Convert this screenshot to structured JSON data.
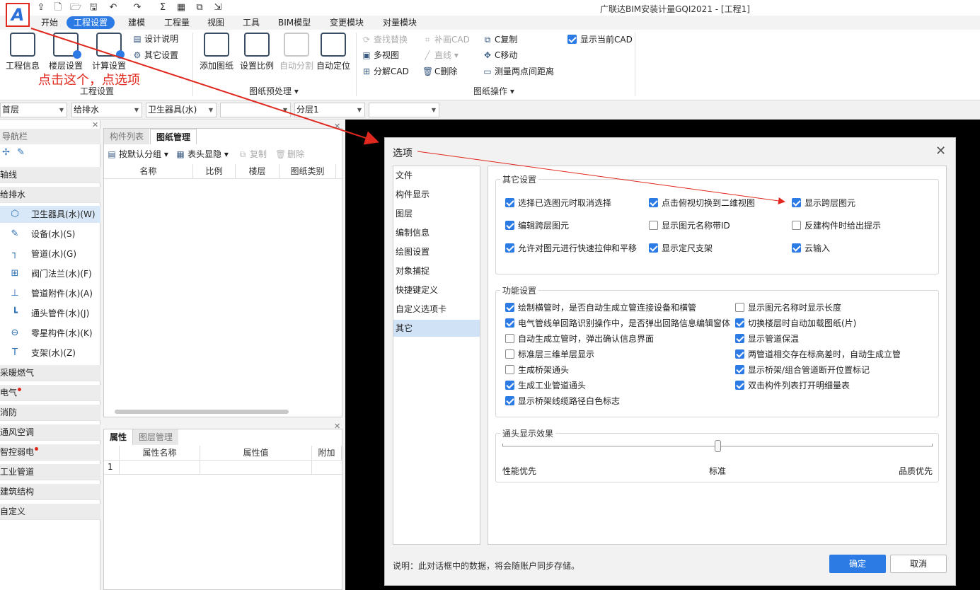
{
  "app": {
    "title": "广联达BIM安装计量GQI2021 - [工程1]",
    "logo_letter": "A"
  },
  "quick_access": [
    "upload-icon",
    "new-file-icon",
    "open-folder-icon",
    "save-icon",
    "undo-icon",
    "redo-icon",
    "sync-icon",
    "sum-icon",
    "grid-icon",
    "copy-icon",
    "export-icon"
  ],
  "menu": [
    {
      "label": "开始"
    },
    {
      "label": "工程设置",
      "active": true
    },
    {
      "label": "建模"
    },
    {
      "label": "工程量"
    },
    {
      "label": "视图"
    },
    {
      "label": "工具"
    },
    {
      "label": "BIM模型"
    },
    {
      "label": "变更模块"
    },
    {
      "label": "对量模块"
    }
  ],
  "ribbon": {
    "project_info": "工程信息",
    "floor_settings": "楼层设置",
    "calc_settings": "计算设置",
    "design_notes": "设计说明",
    "other_settings": "其它设置",
    "group_project": "工程设置",
    "add_drawing": "添加图纸",
    "set_scale": "设置比例",
    "auto_split": "自动分割",
    "auto_locate": "自动定位",
    "group_preprocess": "图纸预处理",
    "find_replace": "查找替换",
    "patch_cad": "补画CAD",
    "c_copy": "C复制",
    "show_current_cad": "显示当前CAD",
    "multi_view": "多视图",
    "line": "直线",
    "c_move": "C移动",
    "split_cad": "分解CAD",
    "c_delete": "C删除",
    "measure_distance": "测量两点间距离",
    "group_drawing_ops": "图纸操作"
  },
  "annotation": "点击这个，点选项",
  "selects": [
    "首层",
    "给排水",
    "卫生器具(水)",
    "",
    "分层1",
    ""
  ],
  "nav": {
    "header": "导航栏",
    "categories_top": [
      "轴线",
      "给排水"
    ],
    "items": [
      {
        "label": "卫生器具(水)(W)",
        "icon": "sanitary-icon",
        "selected": true
      },
      {
        "label": "设备(水)(S)",
        "icon": "equipment-icon"
      },
      {
        "label": "管道(水)(G)",
        "icon": "pipe-icon"
      },
      {
        "label": "阀门法兰(水)(F)",
        "icon": "valve-icon"
      },
      {
        "label": "管道附件(水)(A)",
        "icon": "pipe-accessory-icon"
      },
      {
        "label": "通头管件(水)(J)",
        "icon": "fitting-icon"
      },
      {
        "label": "零星构件(水)(K)",
        "icon": "misc-component-icon"
      },
      {
        "label": "支架(水)(Z)",
        "icon": "bracket-icon"
      }
    ],
    "categories_bottom": [
      {
        "label": "采暖燃气",
        "dot": false
      },
      {
        "label": "电气",
        "dot": true
      },
      {
        "label": "消防",
        "dot": false
      },
      {
        "label": "通风空调",
        "dot": false
      },
      {
        "label": "智控弱电",
        "dot": true
      },
      {
        "label": "工业管道",
        "dot": false
      },
      {
        "label": "建筑结构",
        "dot": false
      },
      {
        "label": "自定义",
        "dot": false
      }
    ]
  },
  "panel_drawings": {
    "tabs": [
      "构件列表",
      "图纸管理"
    ],
    "toolbar": {
      "group": "按默认分组",
      "header_show": "表头显隐",
      "copy": "复制",
      "delete": "删除"
    },
    "columns": [
      "名称",
      "比例",
      "楼层",
      "图纸类别"
    ]
  },
  "panel_props": {
    "tabs": [
      "属性",
      "图层管理"
    ],
    "columns": [
      "属性名称",
      "属性值",
      "附加"
    ],
    "row_numbers": [
      "1"
    ]
  },
  "dialog": {
    "title": "选项",
    "nav": [
      {
        "label": "文件"
      },
      {
        "label": "构件显示"
      },
      {
        "label": "图层"
      },
      {
        "label": "编制信息"
      },
      {
        "label": "绘图设置"
      },
      {
        "label": "对象捕捉"
      },
      {
        "label": "快捷键定义"
      },
      {
        "label": "自定义选项卡"
      },
      {
        "label": "其它",
        "selected": true
      }
    ],
    "other_settings": {
      "title": "其它设置",
      "options": [
        {
          "label": "选择已选图元时取消选择",
          "checked": true
        },
        {
          "label": "点击俯视切换到二维视图",
          "checked": true
        },
        {
          "label": "显示跨层图元",
          "checked": true
        },
        {
          "label": "编辑跨层图元",
          "checked": true
        },
        {
          "label": "显示图元名称带ID",
          "checked": false
        },
        {
          "label": "反建构件时给出提示",
          "checked": false
        },
        {
          "label": "允许对图元进行快速拉伸和平移",
          "checked": true
        },
        {
          "label": "显示定尺支架",
          "checked": true
        },
        {
          "label": "云输入",
          "checked": true
        }
      ]
    },
    "function_settings": {
      "title": "功能设置",
      "left": [
        {
          "label": "绘制横管时，是否自动生成立管连接设备和横管",
          "checked": true
        },
        {
          "label": "电气管线单回路识别操作中，是否弹出回路信息编辑窗体",
          "checked": true
        },
        {
          "label": "自动生成立管时，弹出确认信息界面",
          "checked": false
        },
        {
          "label": "标准层三维单层显示",
          "checked": false
        },
        {
          "label": "生成桥架通头",
          "checked": false
        },
        {
          "label": "生成工业管道通头",
          "checked": true
        },
        {
          "label": "显示桥架线缆路径白色标志",
          "checked": true
        }
      ],
      "right": [
        {
          "label": "显示图元名称时显示长度",
          "checked": false
        },
        {
          "label": "切换楼层时自动加载图纸(片)",
          "checked": true
        },
        {
          "label": "显示管道保温",
          "checked": true
        },
        {
          "label": "两管道相交存在标高差时，自动生成立管",
          "checked": true
        },
        {
          "label": "显示桥架/组合管道断开位置标记",
          "checked": true
        },
        {
          "label": "双击构件列表打开明细量表",
          "checked": true
        }
      ]
    },
    "fitting_effect": {
      "title": "通头显示效果",
      "labels": [
        "性能优先",
        "标准",
        "品质优先"
      ],
      "level": 0.5
    },
    "note": "说明：此对话框中的数据，将会随账户同步存储。",
    "ok": "确定",
    "cancel": "取消"
  },
  "colors": {
    "accent": "#2c7be5",
    "annotation": "#e0281e"
  }
}
